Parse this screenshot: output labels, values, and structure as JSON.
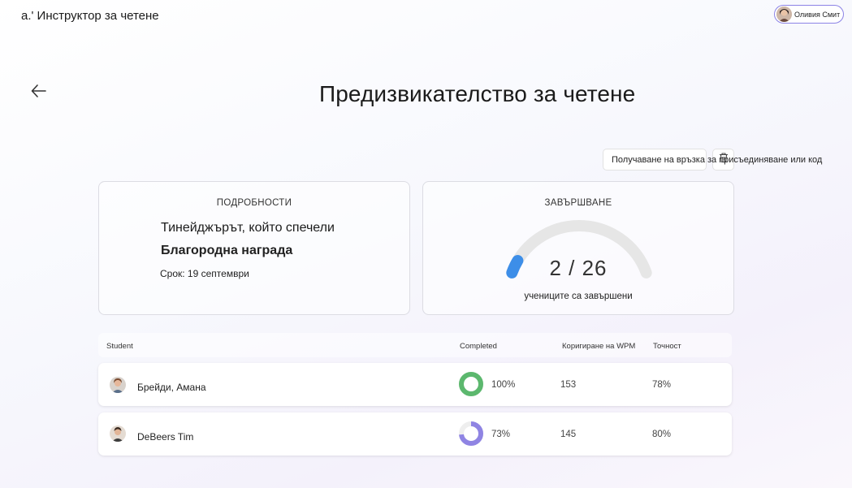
{
  "app": {
    "title": "a.' Инструктор за четене"
  },
  "user": {
    "name": "Оливия Смит"
  },
  "page": {
    "title": "Предизвикателство за четене"
  },
  "actions": {
    "join_link_label": "Получаване на връзка за присъединяване или код"
  },
  "details": {
    "heading": "ПОДРОБНОСТИ",
    "book_title_line1": "Тинейджърът, който спечели",
    "book_title_line2": "Благородна награда",
    "due": "Срок: 19 септември"
  },
  "completion": {
    "heading": "ЗАВЪРШВАНЕ",
    "completed": 2,
    "total": 26,
    "value_text": "2 / 26",
    "caption": "учениците са завършени",
    "accent_color": "#3d8ee8",
    "track_color": "#e6e6e6"
  },
  "table": {
    "headers": {
      "student": "Student",
      "completed": "Completed",
      "wpm": "Коригиране на WPM",
      "accuracy": "Точност"
    },
    "rows": [
      {
        "name": "Брейди, Амана",
        "completed_pct": 100,
        "completed_text": "100%",
        "wpm": "153",
        "accuracy": "78%",
        "ring_color": "#5cb86e"
      },
      {
        "name": "DeBeers Tim",
        "completed_pct": 73,
        "completed_text": "73%",
        "wpm": "145",
        "accuracy": "80%",
        "ring_color": "#8f84e3"
      }
    ]
  }
}
